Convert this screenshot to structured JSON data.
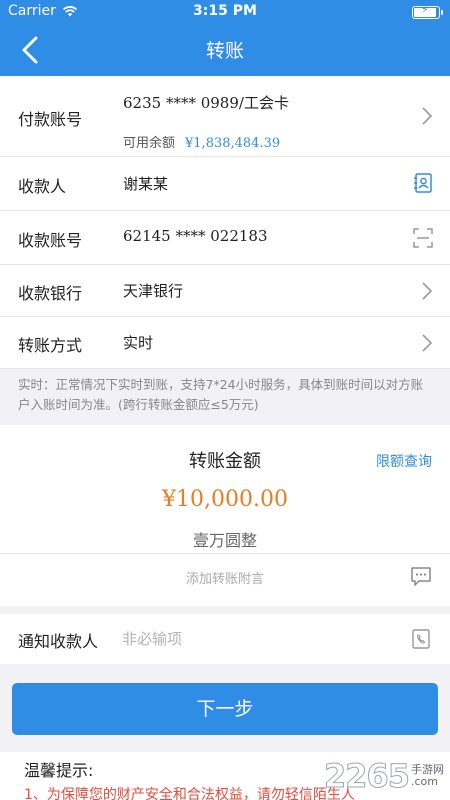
{
  "status_bar": {
    "carrier": "Carrier",
    "time": "3:15 PM",
    "battery_level": 0.95
  },
  "nav": {
    "title": "转账",
    "back_icon": "back-icon"
  },
  "payer": {
    "label": "付款账号",
    "account": "6235 **** 0989/工会卡",
    "available_label": "可用余额",
    "available_amount": "¥1,838,484.39"
  },
  "payee": {
    "label": "收款人",
    "name": "谢某某",
    "icon": "contacts-icon"
  },
  "payee_account": {
    "label": "收款账号",
    "value": "62145 **** 022183",
    "icon": "scan-icon"
  },
  "bank": {
    "label": "收款银行",
    "value": "天津银行"
  },
  "method": {
    "label": "转账方式",
    "value": "实时"
  },
  "notice": "实时：正常情况下实时到账，支持7*24小时服务，具体到账时间以对方账户入账时间为准。(跨行转账金额应≤5万元)",
  "amount": {
    "title": "转账金额",
    "limit_link": "限额查询",
    "value": "¥10,000.00",
    "words": "壹万圆整",
    "memo_placeholder": "添加转账附言",
    "memo_icon": "message-icon"
  },
  "notify": {
    "label": "通知收款人",
    "placeholder": "非必输项",
    "icon": "phone-book-icon"
  },
  "next_button": "下一步",
  "tips": {
    "title": "温馨提示:",
    "line1": "1、为保障您的财产安全和合法权益，请勿轻信陌生人"
  },
  "watermark": {
    "number": "2265",
    "text": "手游网",
    "domain": ".com"
  },
  "colors": {
    "primary": "#2f8de6",
    "amount": "#e67e22",
    "warning": "#e74c3c"
  }
}
